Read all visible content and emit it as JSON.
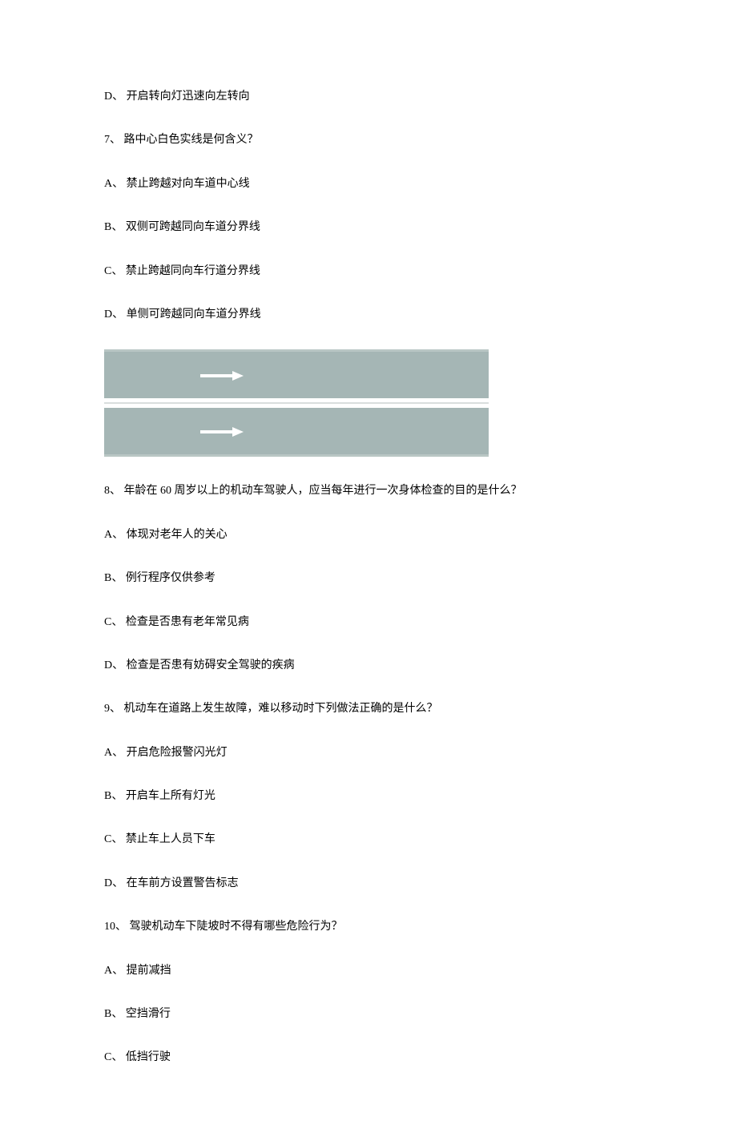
{
  "lines": {
    "prev_d": "D、 开启转向灯迅速向左转向",
    "q7": "7、 路中心白色实线是何含义？",
    "q7_a": "A、 禁止跨越对向车道中心线",
    "q7_b": "B、 双侧可跨越同向车道分界线",
    "q7_c": "C、 禁止跨越同向车行道分界线",
    "q7_d": "D、 单侧可跨越同向车道分界线",
    "q8": "8、 年龄在 60 周岁以上的机动车驾驶人，应当每年进行一次身体检查的目的是什么？",
    "q8_a": "A、 体现对老年人的关心",
    "q8_b": "B、 例行程序仅供参考",
    "q8_c": "C、 检查是否患有老年常见病",
    "q8_d": "D、 检查是否患有妨碍安全驾驶的疾病",
    "q9": "9、 机动车在道路上发生故障，难以移动时下列做法正确的是什么？",
    "q9_a": "A、 开启危险报警闪光灯",
    "q9_b": "B、 开启车上所有灯光",
    "q9_c": "C、 禁止车上人员下车",
    "q9_d": "D、 在车前方设置警告标志",
    "q10": "10、 驾驶机动车下陡坡时不得有哪些危险行为？",
    "q10_a": "A、 提前减挡",
    "q10_b": "B、 空挡滑行",
    "q10_c": "C、 低挡行驶"
  }
}
